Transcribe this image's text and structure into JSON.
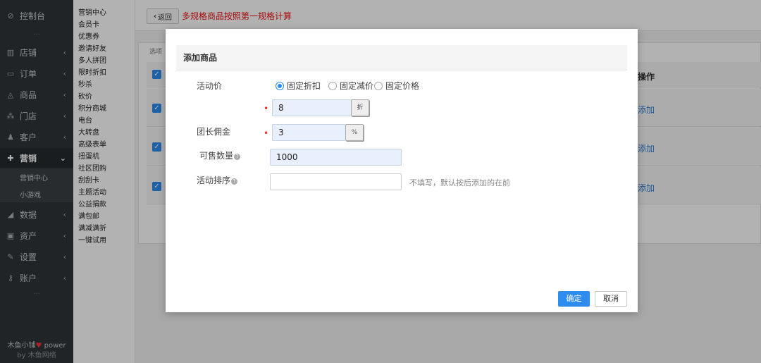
{
  "sidebar": {
    "top": {
      "label": "控制台",
      "icon": "dashboard-icon"
    },
    "items": [
      {
        "label": "店铺",
        "icon": "shop-icon"
      },
      {
        "label": "订单",
        "icon": "order-icon"
      },
      {
        "label": "商品",
        "icon": "goods-icon"
      },
      {
        "label": "门店",
        "icon": "store-icon"
      },
      {
        "label": "客户",
        "icon": "customer-icon"
      },
      {
        "label": "营销",
        "icon": "marketing-icon"
      },
      {
        "label": "数据",
        "icon": "chart-icon"
      },
      {
        "label": "资产",
        "icon": "wallet-icon"
      },
      {
        "label": "设置",
        "icon": "wrench-icon"
      },
      {
        "label": "账户",
        "icon": "key-icon"
      }
    ],
    "subitems": [
      "营销中心",
      "小游戏"
    ],
    "dots": "···",
    "footer_line1": "木鱼小铺",
    "footer_power": "power",
    "footer_line2": "by 木鱼网络"
  },
  "submenu": [
    "营销中心",
    "会员卡",
    "优惠券",
    "邀请好友",
    "多人拼团",
    "限时折扣",
    "秒杀",
    "砍价",
    "积分商城",
    "电台",
    "大转盘",
    "高级表单",
    "扭蛋机",
    "社区团购",
    "刮刮卡",
    "主题活动",
    "公益捐款",
    "满包邮",
    "满减满折",
    "一键试用"
  ],
  "header": {
    "back_label": "返回",
    "title": "多规格商品按照第一规格计算"
  },
  "table": {
    "tab_label": "选项",
    "ops_header": "操作",
    "row_action": "添加"
  },
  "modal": {
    "title": "添加商品",
    "price_label": "活动价",
    "price_options": [
      "固定折扣",
      "固定减价",
      "固定价格"
    ],
    "selected_option": "固定折扣",
    "discount_value": "8",
    "discount_unit": "折",
    "commission_label": "团长佣金",
    "commission_value": "3",
    "commission_unit": "%",
    "stock_label": "可售数量",
    "stock_value": "1000",
    "sort_label": "活动排序",
    "sort_value": "",
    "sort_hint": "不填写，默认按后添加的在前",
    "confirm_label": "确定",
    "cancel_label": "取消"
  },
  "colors": {
    "primary": "#2d8cf0",
    "sidebar": "#2f3437",
    "title_red": "#ee1111"
  }
}
